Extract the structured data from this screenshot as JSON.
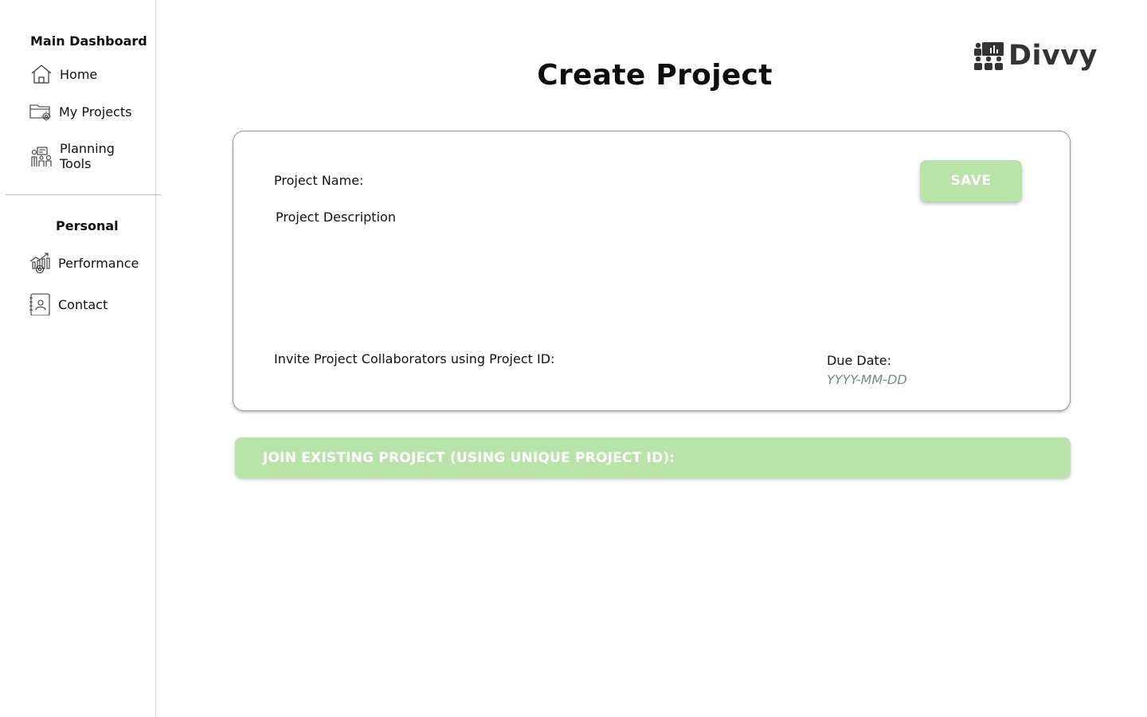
{
  "sidebar": {
    "main_title": "Main Dashboard",
    "personal_title": "Personal",
    "items": [
      {
        "label": "Home",
        "icon": "home-icon"
      },
      {
        "label": "My Projects",
        "icon": "folder-gear-icon"
      },
      {
        "label": "Planning Tools",
        "icon": "team-planning-icon"
      },
      {
        "label": "Performance",
        "icon": "chart-growth-icon"
      },
      {
        "label": "Contact",
        "icon": "contact-book-icon"
      }
    ]
  },
  "header": {
    "title": "Create Project",
    "logo_text": "Divvy",
    "logo_icon": "team-presentation-icon"
  },
  "form": {
    "project_name_label": "Project Name:",
    "project_description_label": "Project Description",
    "invite_label": "Invite Project Collaborators using Project ID:",
    "due_date_label": "Due Date:",
    "due_date_placeholder": "YYYY-MM-DD",
    "save_label": "SAVE"
  },
  "join": {
    "label": "JOIN EXISTING PROJECT (USING UNIQUE PROJECT ID):"
  },
  "colors": {
    "accent_green": "#b9e4a9",
    "placeholder_teal": "#6f8f82",
    "logo_gray": "#333333"
  }
}
